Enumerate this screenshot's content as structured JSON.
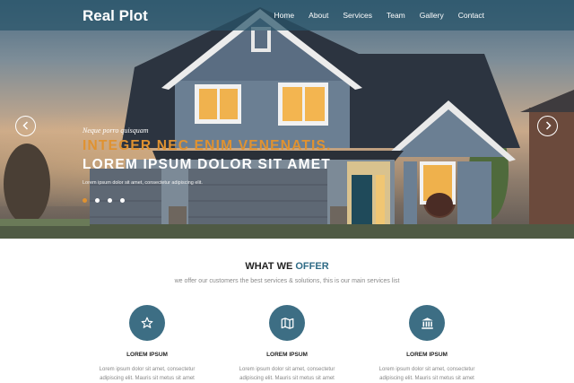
{
  "header": {
    "logo": "Real Plot",
    "nav": [
      "Home",
      "About",
      "Services",
      "Team",
      "Gallery",
      "Contact"
    ]
  },
  "slider": {
    "prev_icon": "chevron-left",
    "next_icon": "chevron-right",
    "subtitle": "Neque porro quisquam",
    "headline_1": "INTEGER NEC ENIM VENENATIS.",
    "headline_2": "LOREM IPSUM DOLOR SIT AMET",
    "body": "Lorem ipsum dolor sit amet, consectetur adipiscing elit.",
    "dots": 4,
    "active_dot": 0,
    "accent_color": "#e09230"
  },
  "offer": {
    "title_plain": "WHAT WE",
    "title_accent": "OFFER",
    "subtitle": "we offer our customers the best services & solutions, this is our main services list",
    "services": [
      {
        "icon": "star-icon",
        "name": "LOREM IPSUM",
        "desc_1": "Lorem ipsum dolor sit amet, consectetur",
        "desc_2": "adipiscing elit. Mauris sit metus sit amet"
      },
      {
        "icon": "map-icon",
        "name": "LOREM IPSUM",
        "desc_1": "Lorem ipsum dolor sit amet, consectetur",
        "desc_2": "adipiscing elit. Mauris sit metus sit amet"
      },
      {
        "icon": "bank-icon",
        "name": "LOREM IPSUM",
        "desc_1": "Lorem ipsum dolor sit amet, consectetur",
        "desc_2": "adipiscing elit. Mauris sit metus sit amet"
      }
    ]
  }
}
